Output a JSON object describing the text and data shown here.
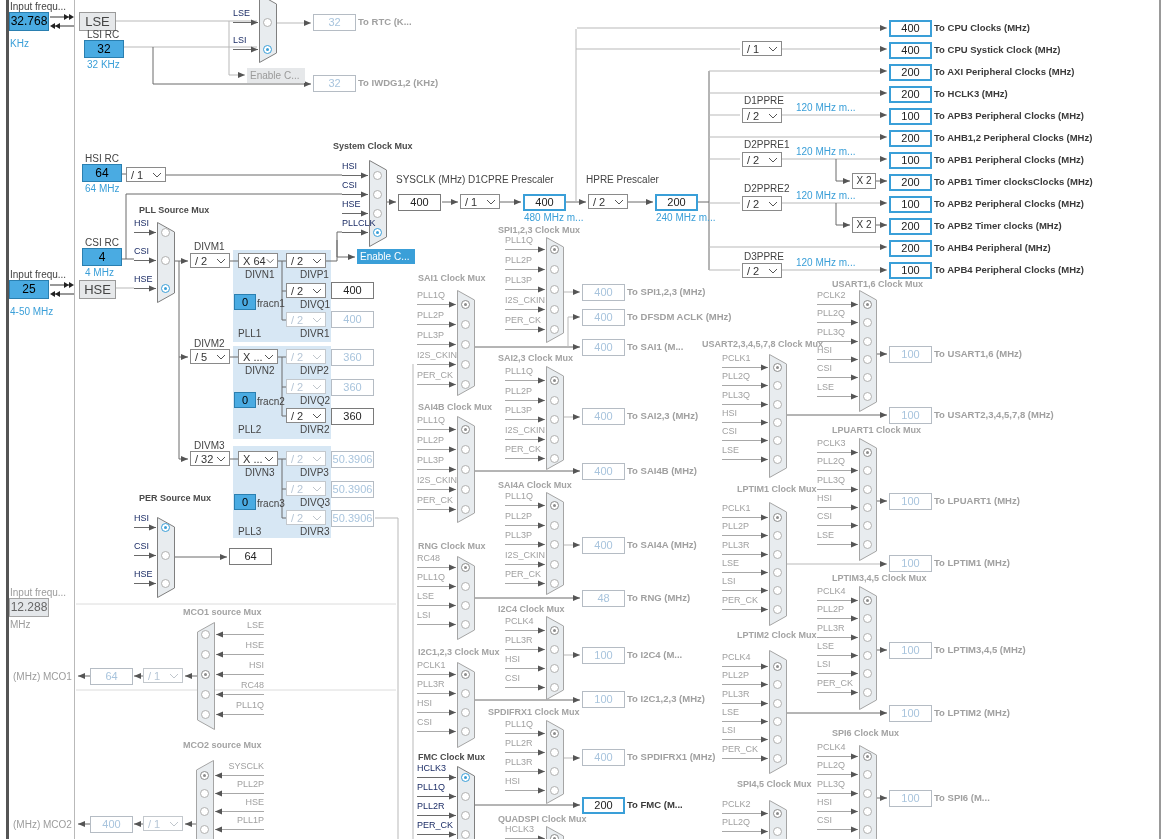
{
  "sources": [
    {
      "kind": "input",
      "caption": "Input frequ...",
      "value": "32.768",
      "unit": "KHz",
      "enabled": true
    },
    {
      "kind": "tag",
      "label": "LSE"
    },
    {
      "kind": "rc",
      "title": "LSI RC",
      "value": "32",
      "unit": "32 KHz"
    },
    {
      "kind": "rc",
      "title": "HSI RC",
      "value": "64",
      "unit": "64 MHz"
    },
    {
      "kind": "rc",
      "title": "CSI RC",
      "value": "4",
      "unit": "4 MHz"
    },
    {
      "kind": "input",
      "caption": "Input frequ...",
      "value": "25",
      "unit": "4-50 MHz",
      "enabled": true
    },
    {
      "kind": "tag",
      "label": "HSE"
    },
    {
      "kind": "input",
      "caption": "Input frequ...",
      "value": "12.288",
      "unit": "MHz",
      "enabled": false
    }
  ],
  "muxes": [
    {
      "active": true,
      "inputs": [
        {
          "label": "LSE",
          "selected": false
        },
        {
          "label": "LSI",
          "selected": true
        }
      ]
    },
    {
      "title": "PLL Source Mux",
      "active": true,
      "inputs": [
        {
          "label": "HSI",
          "selected": false
        },
        {
          "label": "CSI",
          "selected": false
        },
        {
          "label": "HSE",
          "selected": true
        }
      ]
    },
    {
      "title": "System Clock Mux",
      "active": true,
      "inputs": [
        {
          "label": "HSI",
          "selected": false
        },
        {
          "label": "CSI",
          "selected": false
        },
        {
          "label": "HSE",
          "selected": false
        },
        {
          "label": "PLLCLK",
          "selected": true
        }
      ]
    },
    {
      "title": "PER Source Mux",
      "active": true,
      "inputs": [
        {
          "label": "HSI",
          "selected": true
        },
        {
          "label": "CSI",
          "selected": false
        },
        {
          "label": "HSE",
          "selected": false
        }
      ]
    },
    {
      "title": "MCO1 source Mux",
      "active": false,
      "inputs": [
        {
          "label": "LSE",
          "selected": false
        },
        {
          "label": "HSE",
          "selected": false
        },
        {
          "label": "HSI",
          "selected": true
        },
        {
          "label": "RC48",
          "selected": false
        },
        {
          "label": "PLL1Q",
          "selected": false
        }
      ]
    },
    {
      "title": "MCO2 source Mux",
      "active": false,
      "inputs": [
        {
          "label": "SYSCLK",
          "selected": true
        },
        {
          "label": "PLL2P",
          "selected": false
        },
        {
          "label": "HSE",
          "selected": false
        },
        {
          "label": "PLL1P",
          "selected": false
        }
      ]
    },
    {
      "title": "SPI1,2,3 Clock Mux",
      "active": false,
      "inputs": [
        {
          "label": "PLL1Q",
          "selected": true
        },
        {
          "label": "PLL2P",
          "selected": false
        },
        {
          "label": "PLL3P",
          "selected": false
        },
        {
          "label": "I2S_CKIN",
          "selected": false
        },
        {
          "label": "PER_CK",
          "selected": false
        }
      ]
    },
    {
      "title": "SAI1 Clock Mux",
      "active": false,
      "inputs": [
        {
          "label": "PLL1Q",
          "selected": true
        },
        {
          "label": "PLL2P",
          "selected": false
        },
        {
          "label": "PLL3P",
          "selected": false
        },
        {
          "label": "I2S_CKIN",
          "selected": false
        },
        {
          "label": "PER_CK",
          "selected": false
        }
      ]
    },
    {
      "title": "SAI2,3 Clock Mux",
      "active": false,
      "inputs": [
        {
          "label": "PLL1Q",
          "selected": true
        },
        {
          "label": "PLL2P",
          "selected": false
        },
        {
          "label": "PLL3P",
          "selected": false
        },
        {
          "label": "I2S_CKIN",
          "selected": false
        },
        {
          "label": "PER_CK",
          "selected": false
        }
      ]
    },
    {
      "title": "SAI4B Clock Mux",
      "active": false,
      "inputs": [
        {
          "label": "PLL1Q",
          "selected": true
        },
        {
          "label": "PLL2P",
          "selected": false
        },
        {
          "label": "PLL3P",
          "selected": false
        },
        {
          "label": "I2S_CKIN",
          "selected": false
        },
        {
          "label": "PER_CK",
          "selected": false
        }
      ]
    },
    {
      "title": "SAI4A Clock Mux",
      "active": false,
      "inputs": [
        {
          "label": "PLL1Q",
          "selected": true
        },
        {
          "label": "PLL2P",
          "selected": false
        },
        {
          "label": "PLL3P",
          "selected": false
        },
        {
          "label": "I2S_CKIN",
          "selected": false
        },
        {
          "label": "PER_CK",
          "selected": false
        }
      ]
    },
    {
      "title": "RNG Clock Mux",
      "active": false,
      "inputs": [
        {
          "label": "RC48",
          "selected": true
        },
        {
          "label": "PLL1Q",
          "selected": false
        },
        {
          "label": "LSE",
          "selected": false
        },
        {
          "label": "LSI",
          "selected": false
        }
      ]
    },
    {
      "title": "I2C4 Clock Mux",
      "active": false,
      "inputs": [
        {
          "label": "PCLK4",
          "selected": true
        },
        {
          "label": "PLL3R",
          "selected": false
        },
        {
          "label": "HSI",
          "selected": false
        },
        {
          "label": "CSI",
          "selected": false
        }
      ]
    },
    {
      "title": "I2C1,2,3 Clock Mux",
      "active": false,
      "inputs": [
        {
          "label": "PCLK1",
          "selected": true
        },
        {
          "label": "PLL3R",
          "selected": false
        },
        {
          "label": "HSI",
          "selected": false
        },
        {
          "label": "CSI",
          "selected": false
        }
      ]
    },
    {
      "title": "SPDIFRX1 Clock Mux",
      "active": false,
      "inputs": [
        {
          "label": "PLL1Q",
          "selected": true
        },
        {
          "label": "PLL2R",
          "selected": false
        },
        {
          "label": "PLL3R",
          "selected": false
        },
        {
          "label": "HSI",
          "selected": false
        }
      ]
    },
    {
      "title": "FMC Clock Mux",
      "active": true,
      "inputs": [
        {
          "label": "HCLK3",
          "selected": true
        },
        {
          "label": "PLL1Q",
          "selected": false
        },
        {
          "label": "PLL2R",
          "selected": false
        },
        {
          "label": "PER_CK",
          "selected": false
        }
      ]
    },
    {
      "title": "QUADSPI Clock Mux",
      "active": false,
      "inputs": [
        {
          "label": "HCLK3",
          "selected": true
        }
      ]
    },
    {
      "title": "USART2,3,4,5,7,8 Clock Mux",
      "active": false,
      "inputs": [
        {
          "label": "PCLK1",
          "selected": true
        },
        {
          "label": "PLL2Q",
          "selected": false
        },
        {
          "label": "PLL3Q",
          "selected": false
        },
        {
          "label": "HSI",
          "selected": false
        },
        {
          "label": "CSI",
          "selected": false
        },
        {
          "label": "LSE",
          "selected": false
        }
      ]
    },
    {
      "title": "USART1,6 Clock Mux",
      "active": false,
      "inputs": [
        {
          "label": "PCLK2",
          "selected": true
        },
        {
          "label": "PLL2Q",
          "selected": false
        },
        {
          "label": "PLL3Q",
          "selected": false
        },
        {
          "label": "HSI",
          "selected": false
        },
        {
          "label": "CSI",
          "selected": false
        },
        {
          "label": "LSE",
          "selected": false
        }
      ]
    },
    {
      "title": "LPUART1 Clock Mux",
      "active": false,
      "inputs": [
        {
          "label": "PCLK3",
          "selected": true
        },
        {
          "label": "PLL2Q",
          "selected": false
        },
        {
          "label": "PLL3Q",
          "selected": false
        },
        {
          "label": "HSI",
          "selected": false
        },
        {
          "label": "CSI",
          "selected": false
        },
        {
          "label": "LSE",
          "selected": false
        }
      ]
    },
    {
      "title": "LPTIM1 Clock Mux",
      "active": false,
      "inputs": [
        {
          "label": "PCLK1",
          "selected": true
        },
        {
          "label": "PLL2P",
          "selected": false
        },
        {
          "label": "PLL3R",
          "selected": false
        },
        {
          "label": "LSE",
          "selected": false
        },
        {
          "label": "LSI",
          "selected": false
        },
        {
          "label": "PER_CK",
          "selected": false
        }
      ]
    },
    {
      "title": "LPTIM3,4,5 Clock Mux",
      "active": false,
      "inputs": [
        {
          "label": "PCLK4",
          "selected": true
        },
        {
          "label": "PLL2P",
          "selected": false
        },
        {
          "label": "PLL3R",
          "selected": false
        },
        {
          "label": "LSE",
          "selected": false
        },
        {
          "label": "LSI",
          "selected": false
        },
        {
          "label": "PER_CK",
          "selected": false
        }
      ]
    },
    {
      "title": "LPTIM2 Clock Mux",
      "active": false,
      "inputs": [
        {
          "label": "PCLK4",
          "selected": true
        },
        {
          "label": "PLL2P",
          "selected": false
        },
        {
          "label": "PLL3R",
          "selected": false
        },
        {
          "label": "LSE",
          "selected": false
        },
        {
          "label": "LSI",
          "selected": false
        },
        {
          "label": "PER_CK",
          "selected": false
        }
      ]
    },
    {
      "title": "SPI4,5 Clock Mux",
      "active": false,
      "inputs": [
        {
          "label": "PCLK2",
          "selected": true
        },
        {
          "label": "PLL2Q",
          "selected": false
        }
      ]
    },
    {
      "title": "SPI6 Clock Mux",
      "active": false,
      "inputs": [
        {
          "label": "PCLK4",
          "selected": true
        },
        {
          "label": "PLL2Q",
          "selected": false
        },
        {
          "label": "PLL3Q",
          "selected": false
        },
        {
          "label": "HSI",
          "selected": false
        },
        {
          "label": "CSI",
          "selected": false
        }
      ]
    }
  ],
  "prescalers": [
    {
      "value": "/ 1",
      "enabled": true
    },
    {
      "value": "/ 2",
      "enabled": true
    },
    {
      "value": "X 64",
      "enabled": true
    },
    {
      "value": "/ 2",
      "enabled": true
    },
    {
      "value": "/ 2",
      "enabled": true
    },
    {
      "value": "/ 2",
      "enabled": false
    },
    {
      "value": "/ 5",
      "enabled": true
    },
    {
      "value": "X ...",
      "enabled": true
    },
    {
      "value": "/ 2",
      "enabled": false
    },
    {
      "value": "/ 2",
      "enabled": false
    },
    {
      "value": "/ 2",
      "enabled": true
    },
    {
      "value": "/ 32",
      "enabled": true
    },
    {
      "value": "X ...",
      "enabled": true
    },
    {
      "value": "/ 2",
      "enabled": false
    },
    {
      "value": "/ 2",
      "enabled": false
    },
    {
      "value": "/ 2",
      "enabled": false
    },
    {
      "value": "/ 1",
      "enabled": true
    },
    {
      "value": "/ 2",
      "enabled": true
    },
    {
      "value": "/ 1",
      "enabled": true
    },
    {
      "value": "/ 2",
      "enabled": true
    },
    {
      "value": "/ 2",
      "enabled": true
    },
    {
      "value": "/ 2",
      "enabled": true
    },
    {
      "value": "/ 2",
      "enabled": true
    },
    {
      "value": "/ 1",
      "enabled": false
    },
    {
      "value": "/ 1",
      "enabled": false
    }
  ],
  "outputs": [
    {
      "value": "32",
      "label": "To RTC (K...",
      "enabled": false,
      "highlighted": false
    },
    {
      "value": "32",
      "label": "To IWDG1,2 (KHz)",
      "enabled": false,
      "highlighted": false
    },
    {
      "value": "400",
      "enabled": true,
      "highlighted": false
    },
    {
      "value": "400",
      "enabled": true,
      "highlighted": true
    },
    {
      "value": "200",
      "enabled": true,
      "highlighted": true
    },
    {
      "value": "400",
      "label": "To CPU Clocks (MHz)",
      "enabled": true,
      "highlighted": true
    },
    {
      "value": "400",
      "label": "To CPU Systick Clock (MHz)",
      "enabled": true,
      "highlighted": true
    },
    {
      "value": "200",
      "label": "To AXI Peripheral Clocks (MHz)",
      "enabled": true,
      "highlighted": true
    },
    {
      "value": "200",
      "label": "To HCLK3 (MHz)",
      "enabled": true,
      "highlighted": true
    },
    {
      "value": "100",
      "label": "To APB3 Peripheral Clocks (MHz)",
      "enabled": true,
      "highlighted": true
    },
    {
      "value": "200",
      "label": "To AHB1,2 Peripheral Clocks (MHz)",
      "enabled": true,
      "highlighted": true
    },
    {
      "value": "100",
      "label": "To APB1 Peripheral Clocks (MHz)",
      "enabled": true,
      "highlighted": true
    },
    {
      "value": "200",
      "label": "To APB1 Timer clocksClocks (MHz)",
      "enabled": true,
      "highlighted": true
    },
    {
      "value": "100",
      "label": "To APB2 Peripheral Clocks (MHz)",
      "enabled": true,
      "highlighted": true
    },
    {
      "value": "200",
      "label": "To APB2 Timer clocks (MHz)",
      "enabled": true,
      "highlighted": true
    },
    {
      "value": "200",
      "label": "To AHB4 Peripheral (MHz)",
      "enabled": true,
      "highlighted": true
    },
    {
      "value": "100",
      "label": "To APB4 Peripheral Clocks (MHz)",
      "enabled": true,
      "highlighted": true
    },
    {
      "value": "400",
      "enabled": true,
      "highlighted": false
    },
    {
      "value": "400",
      "enabled": false,
      "highlighted": false
    },
    {
      "value": "360",
      "enabled": false,
      "highlighted": false
    },
    {
      "value": "360",
      "enabled": false,
      "highlighted": false
    },
    {
      "value": "360",
      "enabled": true,
      "highlighted": false
    },
    {
      "value": "50.3906",
      "enabled": false,
      "highlighted": false
    },
    {
      "value": "50.3906",
      "enabled": false,
      "highlighted": false
    },
    {
      "value": "50.3906",
      "enabled": false,
      "highlighted": false
    },
    {
      "value": "64",
      "enabled": true,
      "highlighted": false
    },
    {
      "value": "64",
      "enabled": false,
      "highlighted": false
    },
    {
      "value": "400",
      "enabled": false,
      "highlighted": false
    },
    {
      "value": "400",
      "label": "To SPI1,2,3 (MHz)",
      "enabled": false,
      "highlighted": false
    },
    {
      "value": "400",
      "label": "To DFSDM ACLK (MHz)",
      "enabled": false,
      "highlighted": false
    },
    {
      "value": "400",
      "label": "To SAI1 (M...",
      "enabled": false,
      "highlighted": false
    },
    {
      "value": "400",
      "label": "To SAI2,3 (MHz)",
      "enabled": false,
      "highlighted": false
    },
    {
      "value": "400",
      "label": "To SAI4B (MHz)",
      "enabled": false,
      "highlighted": false
    },
    {
      "value": "400",
      "label": "To SAI4A (MHz)",
      "enabled": false,
      "highlighted": false
    },
    {
      "value": "48",
      "label": "To RNG (MHz)",
      "enabled": false,
      "highlighted": false
    },
    {
      "value": "100",
      "label": "To I2C4 (M...",
      "enabled": false,
      "highlighted": false
    },
    {
      "value": "100",
      "label": "To I2C1,2,3 (MHz)",
      "enabled": false,
      "highlighted": false
    },
    {
      "value": "400",
      "label": "To SPDIFRX1 (MHz)",
      "enabled": false,
      "highlighted": false
    },
    {
      "value": "200",
      "label": "To FMC (M...",
      "enabled": true,
      "highlighted": true
    },
    {
      "value": "100",
      "label": "To USART1,6 (MHz)",
      "enabled": false,
      "highlighted": false
    },
    {
      "value": "100",
      "label": "To USART2,3,4,5,7,8 (MHz)",
      "enabled": false,
      "highlighted": false
    },
    {
      "value": "100",
      "label": "To LPUART1 (MHz)",
      "enabled": false,
      "highlighted": false
    },
    {
      "value": "100",
      "label": "To LPTIM1 (MHz)",
      "enabled": false,
      "highlighted": false
    },
    {
      "value": "100",
      "label": "To LPTIM3,4,5 (MHz)",
      "enabled": false,
      "highlighted": false
    },
    {
      "value": "100",
      "label": "To LPTIM2 (MHz)",
      "enabled": false,
      "highlighted": false
    },
    {
      "value": "100",
      "label": "To SPI6 (M...",
      "enabled": false,
      "highlighted": false
    }
  ],
  "captions": [
    {
      "text": "SYSCLK (MHz)",
      "kind": "text"
    },
    {
      "text": "D1CPRE Prescaler",
      "kind": "text"
    },
    {
      "text": "HPRE Prescaler",
      "kind": "text"
    },
    {
      "text": "480 MHz m...",
      "kind": "hint"
    },
    {
      "text": "240 MHz m...",
      "kind": "hint"
    },
    {
      "text": "D1PPRE",
      "kind": "text"
    },
    {
      "text": "D2PPRE1",
      "kind": "text"
    },
    {
      "text": "D2PPRE2",
      "kind": "text"
    },
    {
      "text": "D3PPRE",
      "kind": "text"
    },
    {
      "text": "120 MHz m...",
      "kind": "hint"
    },
    {
      "text": "120 MHz m...",
      "kind": "hint"
    },
    {
      "text": "120 MHz m...",
      "kind": "hint"
    },
    {
      "text": "120 MHz m...",
      "kind": "hint"
    },
    {
      "text": "DIVM1",
      "kind": "text"
    },
    {
      "text": "DIVN1",
      "kind": "text"
    },
    {
      "text": "DIVP1",
      "kind": "text"
    },
    {
      "text": "fracn1",
      "kind": "text"
    },
    {
      "text": "DIVQ1",
      "kind": "text"
    },
    {
      "text": "DIVR1",
      "kind": "text"
    },
    {
      "text": "PLL1",
      "kind": "text"
    },
    {
      "text": "DIVM2",
      "kind": "text"
    },
    {
      "text": "DIVN2",
      "kind": "text"
    },
    {
      "text": "DIVP2",
      "kind": "text"
    },
    {
      "text": "fracn2",
      "kind": "text"
    },
    {
      "text": "DIVQ2",
      "kind": "text"
    },
    {
      "text": "DIVR2",
      "kind": "text"
    },
    {
      "text": "PLL2",
      "kind": "text"
    },
    {
      "text": "DIVM3",
      "kind": "text"
    },
    {
      "text": "DIVN3",
      "kind": "text"
    },
    {
      "text": "DIVP3",
      "kind": "text"
    },
    {
      "text": "fracn3",
      "kind": "text"
    },
    {
      "text": "DIVQ3",
      "kind": "text"
    },
    {
      "text": "DIVR3",
      "kind": "text"
    },
    {
      "text": "PLL3",
      "kind": "text"
    },
    {
      "text": "(MHz) MCO1",
      "kind": "muted"
    },
    {
      "text": "(MHz) MCO2",
      "kind": "muted"
    }
  ],
  "fractions": [
    {
      "value": "0"
    },
    {
      "value": "0"
    },
    {
      "value": "0"
    }
  ],
  "enable_buttons": [
    {
      "label": "Enable C...",
      "enabled": false
    },
    {
      "label": "Enable C...",
      "enabled": true
    }
  ],
  "multipliers": [
    {
      "label": "X 2"
    },
    {
      "label": "X 2"
    }
  ]
}
